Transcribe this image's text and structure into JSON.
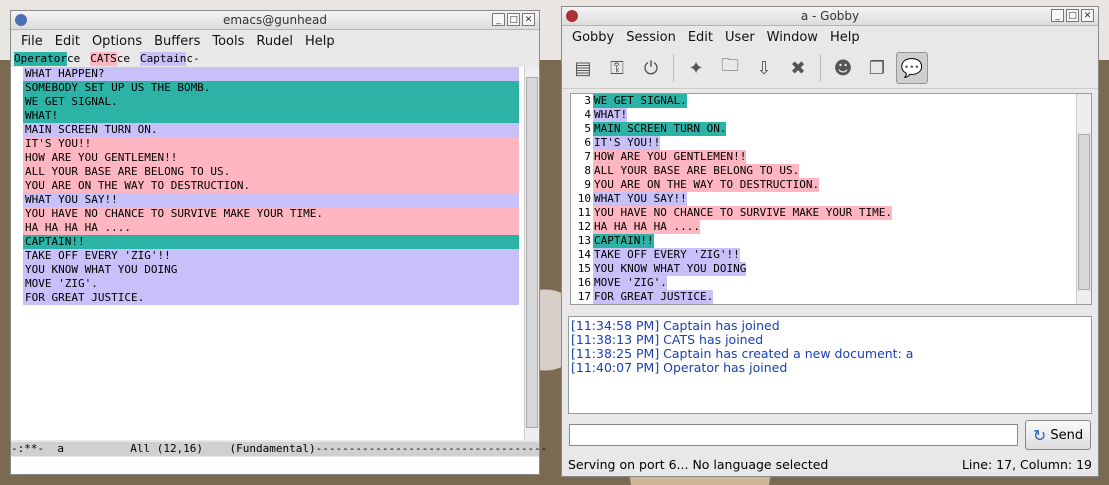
{
  "emacs": {
    "title": "emacs@gunhead",
    "menu": [
      "File",
      "Edit",
      "Options",
      "Buffers",
      "Tools",
      "Rudel",
      "Help"
    ],
    "users": [
      {
        "name": "Operator",
        "suffix": "ce",
        "color": "#2db3a6"
      },
      {
        "name": "CATS",
        "suffix": "ce",
        "color": "#ffb6c1"
      },
      {
        "name": "Captain",
        "suffix": "c-",
        "color": "#c8c0f8"
      }
    ],
    "lines": [
      {
        "text": "WHAT HAPPEN?",
        "color": "#c8c0f8"
      },
      {
        "text": "SOMEBODY SET UP US THE BOMB.",
        "color": "#2db3a6"
      },
      {
        "text": "WE GET SIGNAL.",
        "color": "#2db3a6"
      },
      {
        "text": "WHAT!",
        "color": "#2db3a6"
      },
      {
        "text": "MAIN SCREEN TURN ON.",
        "color": "#c8c0f8"
      },
      {
        "text": "IT'S YOU!!",
        "color": "#ffb6c1"
      },
      {
        "text": "HOW ARE YOU GENTLEMEN!!",
        "color": "#ffb6c1"
      },
      {
        "text": "ALL YOUR BASE ARE BELONG TO US.",
        "color": "#ffb6c1"
      },
      {
        "text": "YOU ARE ON THE WAY TO DESTRUCTION.",
        "color": "#ffb6c1"
      },
      {
        "text": "WHAT YOU SAY!!",
        "color": "#c8c0f8"
      },
      {
        "text": "YOU HAVE NO CHANCE TO SURVIVE MAKE YOUR TIME.",
        "color": "#ffb6c1"
      },
      {
        "text": "HA HA HA HA ....",
        "color": "#ffb6c1"
      },
      {
        "text": "CAPTAIN!!",
        "color": "#2db3a6"
      },
      {
        "text": "TAKE OFF EVERY 'ZIG'!!",
        "color": "#c8c0f8"
      },
      {
        "text": "YOU KNOW WHAT YOU DOING",
        "color": "#c8c0f8"
      },
      {
        "text": "MOVE 'ZIG'.",
        "color": "#c8c0f8"
      },
      {
        "text": "FOR GREAT JUSTICE.",
        "color": "#c8c0f8"
      }
    ],
    "modeline": "-:**-  a          All (12,16)    (Fundamental)-----------------------------------"
  },
  "gobby": {
    "title": "a - Gobby",
    "menu": [
      "Gobby",
      "Session",
      "Edit",
      "User",
      "Window",
      "Help"
    ],
    "toolbar_icons": [
      "create-session-icon",
      "join-session-icon",
      "quit-session-icon",
      "new-document-icon",
      "open-document-icon",
      "save-document-icon",
      "close-document-icon",
      "user-list-icon",
      "document-list-icon",
      "chat-icon"
    ],
    "lines": [
      {
        "num": "3",
        "text": "WE GET SIGNAL.",
        "color": "#2db3a6"
      },
      {
        "num": "4",
        "text": "WHAT!",
        "color": "#c8c0f8"
      },
      {
        "num": "5",
        "text": "MAIN SCREEN TURN ON.",
        "color": "#2db3a6"
      },
      {
        "num": "6",
        "text": "IT'S YOU!!",
        "color": "#c8c0f8"
      },
      {
        "num": "7",
        "text": "HOW ARE YOU GENTLEMEN!!",
        "color": "#ffb6c1"
      },
      {
        "num": "8",
        "text": "ALL YOUR BASE ARE BELONG TO US.",
        "color": "#ffb6c1"
      },
      {
        "num": "9",
        "text": "YOU ARE ON THE WAY TO DESTRUCTION.",
        "color": "#ffb6c1"
      },
      {
        "num": "10",
        "text": "WHAT YOU SAY!!",
        "color": "#c8c0f8"
      },
      {
        "num": "11",
        "text": "YOU HAVE NO CHANCE TO SURVIVE MAKE YOUR TIME.",
        "color": "#ffb6c1"
      },
      {
        "num": "12",
        "text": "HA HA HA HA ....",
        "color": "#ffb6c1"
      },
      {
        "num": "13",
        "text": "CAPTAIN!!",
        "color": "#2db3a6"
      },
      {
        "num": "14",
        "text": "TAKE OFF EVERY 'ZIG'!!",
        "color": "#c8c0f8"
      },
      {
        "num": "15",
        "text": "YOU KNOW WHAT YOU DOING",
        "color": "#c8c0f8"
      },
      {
        "num": "16",
        "text": "MOVE 'ZIG'.",
        "color": "#c8c0f8"
      },
      {
        "num": "17",
        "text": "FOR GREAT JUSTICE.",
        "color": "#c8c0f8"
      }
    ],
    "chat": [
      "[11:34:58 PM] Captain has joined",
      "[11:38:13 PM] CATS has joined",
      "[11:38:25 PM] Captain has created a new document: a",
      "[11:40:07 PM] Operator has joined"
    ],
    "send_label": "Send",
    "status_left": "Serving on port 6...  No language selected",
    "status_right": "Line: 17, Column: 19"
  }
}
